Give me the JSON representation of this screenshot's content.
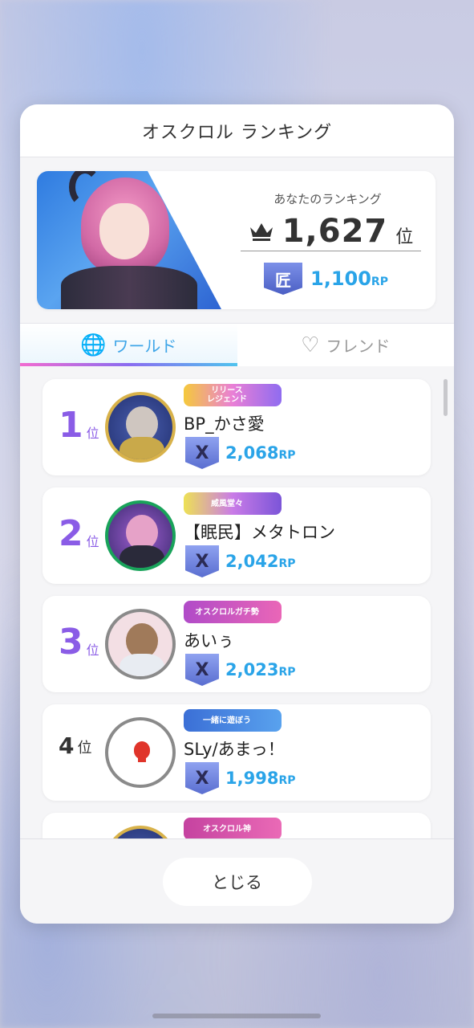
{
  "modal": {
    "title": "オスクロル ランキング",
    "close_label": "とじる"
  },
  "my_ranking": {
    "label": "あなたのランキング",
    "rank": "1,627",
    "rank_unit": "位",
    "rp_value": "1,100",
    "rp_unit": "RP",
    "rp_tier_icon": "匠"
  },
  "tabs": [
    {
      "label": "ワールド",
      "icon": "globe-icon",
      "active": true
    },
    {
      "label": "フレンド",
      "icon": "handshake-icon",
      "active": false
    }
  ],
  "rank_unit": "位",
  "rp_unit": "RP",
  "rp_icon_glyph": "X",
  "rows": [
    {
      "rank": "1",
      "name": "BP_かさ愛",
      "rp": "2,068",
      "badge": "リリース\nレジェンド",
      "badge_style": "legend"
    },
    {
      "rank": "2",
      "name": "【眠民】メタトロン",
      "rp": "2,042",
      "badge": "威風堂々",
      "badge_style": "iryu"
    },
    {
      "rank": "3",
      "name": "あいぅ",
      "rp": "2,023",
      "badge": "オスクロルガチ勢",
      "badge_style": "gachi"
    },
    {
      "rank": "4",
      "name": "SLy/あまっ！",
      "rp": "1,998",
      "badge": "一緒に遊ぼう",
      "badge_style": "asobo"
    },
    {
      "rank": "",
      "name": "",
      "rp": "",
      "badge": "オスクロル神",
      "badge_style": "kami"
    }
  ],
  "colors": {
    "accent_blue": "#2aa4e8",
    "rank_purple": "#8a5ce6",
    "tab_gradient": [
      "#f26bd0",
      "#8a6cf0",
      "#4fc3ee"
    ]
  }
}
